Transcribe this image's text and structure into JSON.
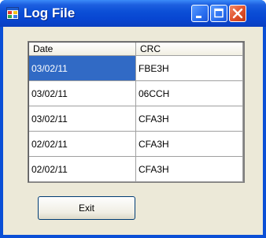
{
  "window": {
    "title": "Log File"
  },
  "titlebar_buttons": {
    "minimize": "minimize-icon",
    "maximize": "maximize-icon",
    "close": "close-icon"
  },
  "grid": {
    "columns": [
      "Date",
      "CRC"
    ],
    "rows": [
      [
        "03/02/11",
        "FBE3H"
      ],
      [
        "03/02/11",
        "06CCH"
      ],
      [
        "03/02/11",
        "CFA3H"
      ],
      [
        "02/02/11",
        "CFA3H"
      ],
      [
        "02/02/11",
        "CFA3H"
      ]
    ],
    "selected_row": 0
  },
  "actions": {
    "exit_label": "Exit"
  },
  "colors": {
    "title_bar": "#0b4ed6",
    "selection": "#316ac5",
    "client_bg": "#ece9d8"
  }
}
